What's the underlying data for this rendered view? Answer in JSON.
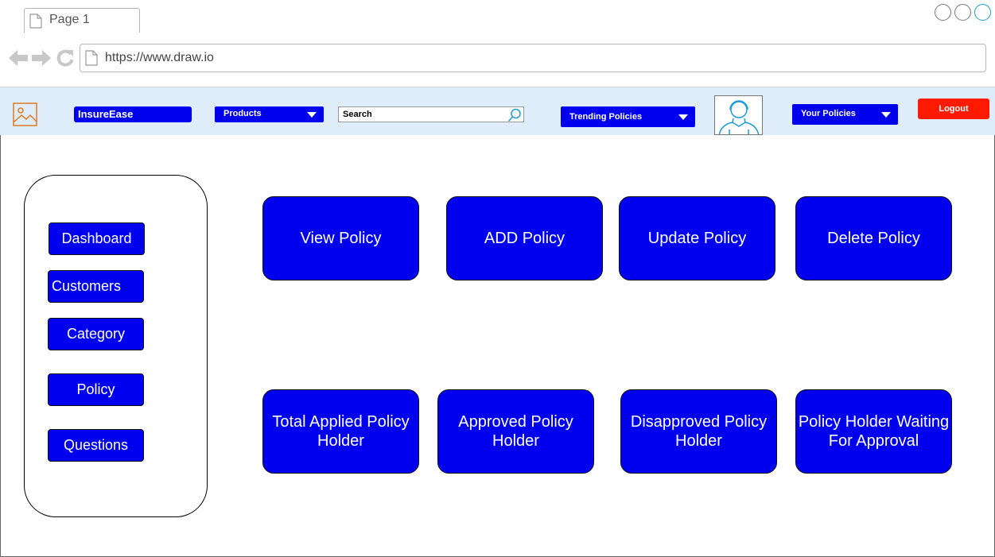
{
  "browser": {
    "tab_title": "Page 1",
    "url": "https://www.draw.io",
    "accent": "#1a9bd6"
  },
  "header": {
    "brand": "InsureEase",
    "products_label": "Products",
    "search_placeholder": "Search",
    "trending_label": "Trending Policies",
    "your_policies_label": "Your Policies",
    "logout_label": "Logout",
    "bg_color": "#deedf9",
    "button_color": "#0000ee",
    "logout_color": "#ff1a00"
  },
  "sidebar": {
    "items": [
      {
        "label": "Dashboard"
      },
      {
        "label": "Customers"
      },
      {
        "label": "Category"
      },
      {
        "label": "Policy"
      },
      {
        "label": "Questions"
      }
    ]
  },
  "cards": {
    "top": [
      {
        "label": "View Policy"
      },
      {
        "label": "ADD Policy"
      },
      {
        "label": "Update Policy"
      },
      {
        "label": "Delete Policy"
      }
    ],
    "bottom": [
      {
        "label": "Total Applied Policy Holder"
      },
      {
        "label": "Approved Policy Holder"
      },
      {
        "label": "Disapproved Policy Holder"
      },
      {
        "label": "Policy Holder Waiting For Approval"
      }
    ]
  }
}
